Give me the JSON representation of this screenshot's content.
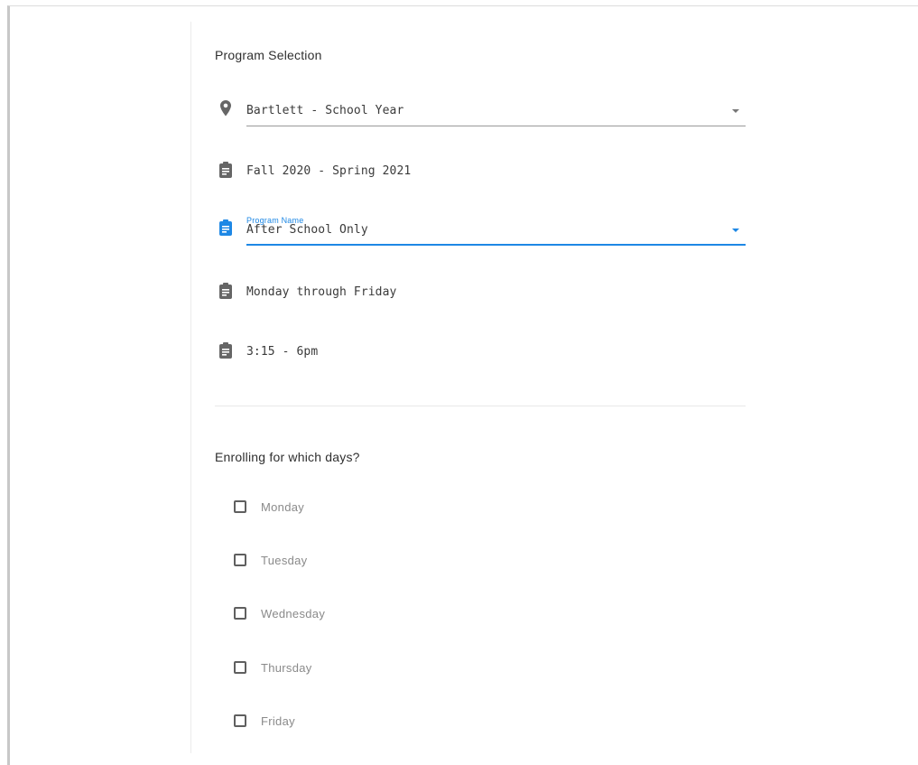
{
  "program_selection": {
    "title": "Program Selection",
    "location": {
      "icon": "map-pin-icon",
      "value": "Bartlett - School Year"
    },
    "term": {
      "icon": "clipboard-icon",
      "value": "Fall 2020 - Spring 2021"
    },
    "program_name": {
      "icon": "clipboard-icon",
      "label": "Program Name",
      "value": "After School Only"
    },
    "schedule_days": {
      "icon": "clipboard-icon",
      "value": "Monday through Friday"
    },
    "schedule_time": {
      "icon": "clipboard-icon",
      "value": "3:15 - 6pm"
    }
  },
  "enrollment": {
    "title": "Enrolling for which days?",
    "days": [
      {
        "label": "Monday",
        "checked": false
      },
      {
        "label": "Tuesday",
        "checked": false
      },
      {
        "label": "Wednesday",
        "checked": false
      },
      {
        "label": "Thursday",
        "checked": false
      },
      {
        "label": "Friday",
        "checked": false
      }
    ]
  },
  "colors": {
    "accent": "#1e88e5",
    "text": "#333333",
    "muted_text": "#8a8a8a",
    "icon": "#666666"
  }
}
